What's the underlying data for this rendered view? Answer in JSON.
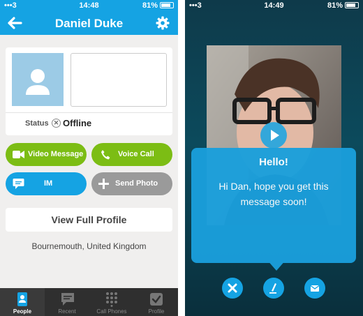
{
  "left": {
    "status_bar": {
      "carrier": "3",
      "time": "14:48",
      "battery": "81%"
    },
    "header": {
      "title": "Daniel Duke"
    },
    "profile": {
      "status_label": "Status",
      "status_value": "Offline"
    },
    "actions": {
      "video_message": "Video Message",
      "voice_call": "Voice Call",
      "im": "IM",
      "send_photo": "Send Photo"
    },
    "view_full_profile": "View Full Profile",
    "location": "Bournemouth, United Kingdom",
    "tabs": [
      {
        "label": "People",
        "icon": "people-icon",
        "active": true
      },
      {
        "label": "Recent",
        "icon": "chat-bubble-icon",
        "active": false
      },
      {
        "label": "Call Phones",
        "icon": "dialpad-icon",
        "active": false
      },
      {
        "label": "Profile",
        "icon": "check-icon",
        "active": false
      }
    ],
    "colors": {
      "accent": "#15a3e3",
      "green": "#7cbd14",
      "grey": "#9a9a9a"
    }
  },
  "right": {
    "status_bar": {
      "carrier": "3",
      "time": "14:49",
      "battery": "81%"
    },
    "message": {
      "title": "Hello!",
      "body": "Hi Dan, hope you get this message soon!"
    },
    "controls": [
      "close-icon",
      "edit-icon",
      "mail-icon"
    ]
  }
}
